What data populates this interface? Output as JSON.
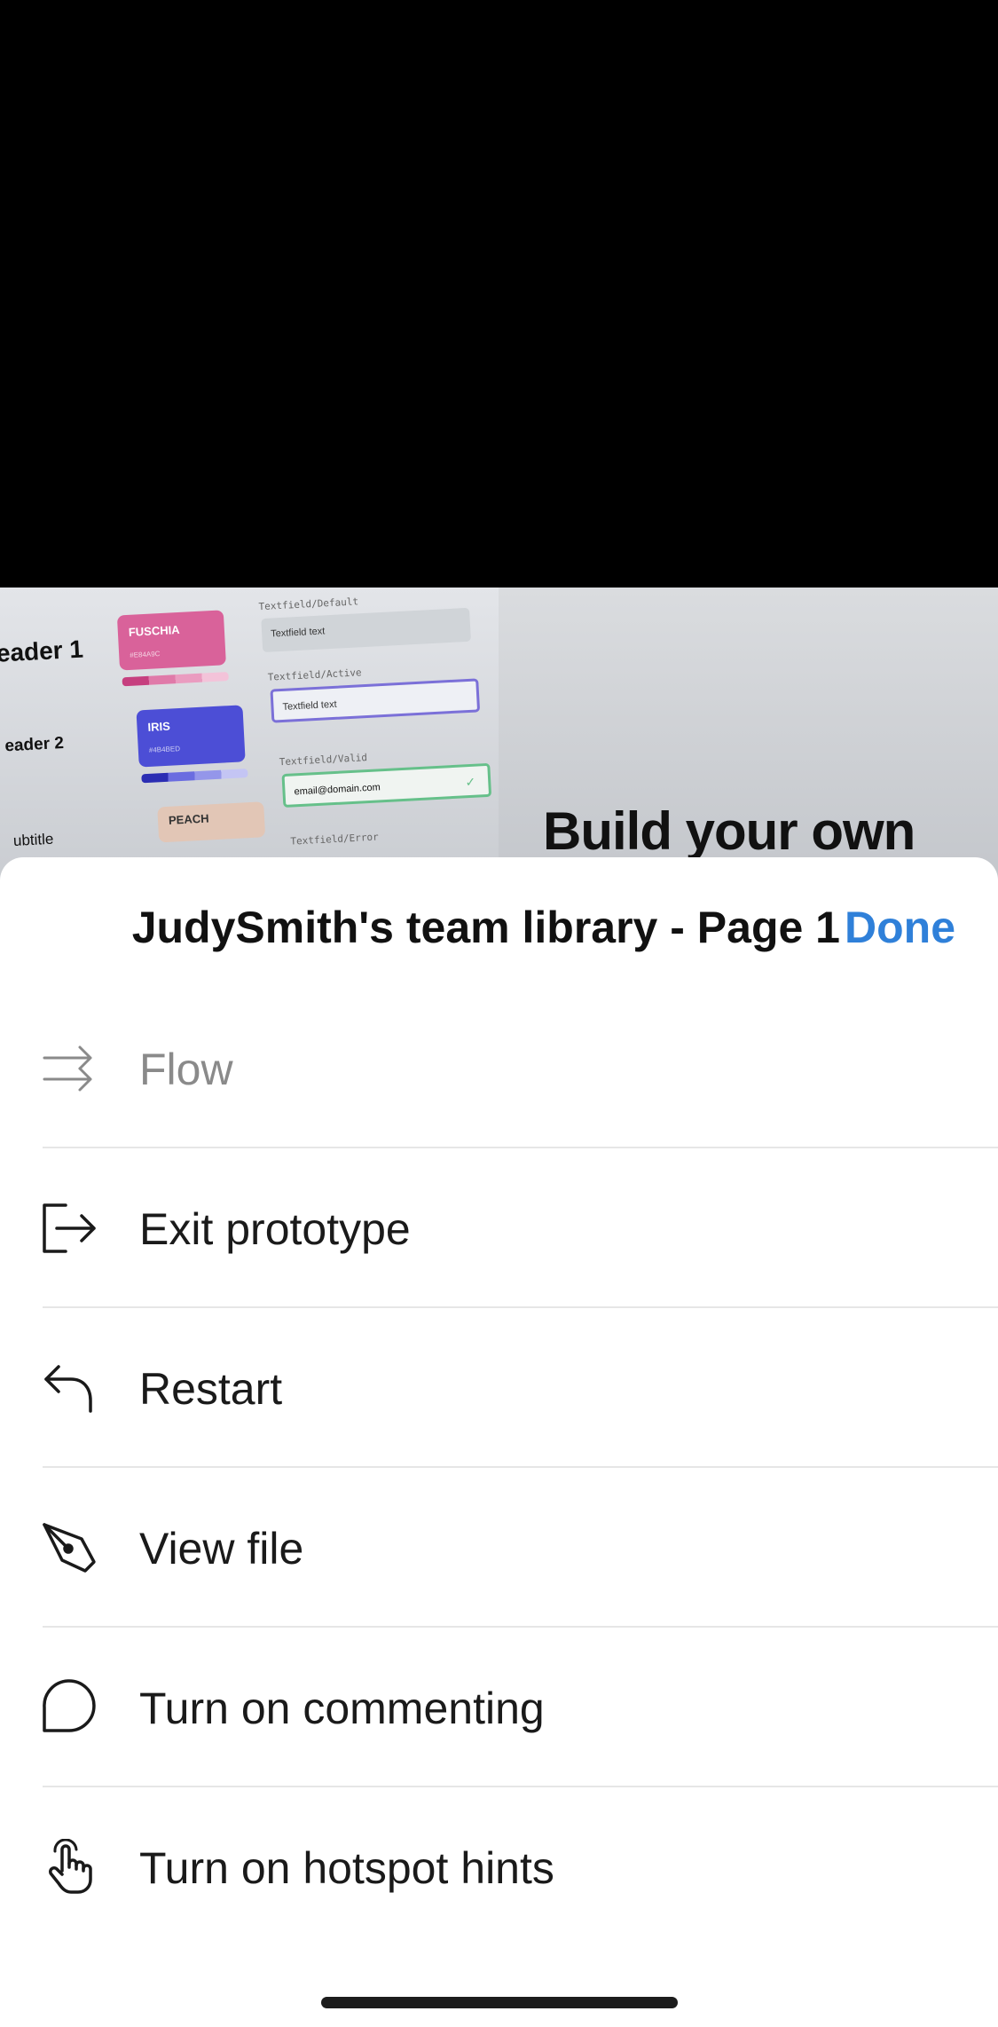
{
  "preview": {
    "header1": "eader 1",
    "header2": "eader 2",
    "subtitle": "ubtitle",
    "swatch_fuschia": "FUSCHIA",
    "swatch_fuschia_hex": "#E84A9C",
    "swatch_iris": "IRIS",
    "swatch_iris_hex": "#4B4BED",
    "swatch_peach": "PEACH",
    "tf_default_label": "Textfield/Default",
    "tf_default_text": "Textfield text",
    "tf_active_label": "Textfield/Active",
    "tf_active_text": "Textfield text",
    "tf_valid_label": "Textfield/Valid",
    "tf_valid_text": "email@domain.com",
    "tf_error_label": "Textfield/Error",
    "build_text": "Build your own",
    "colors": {
      "fuschia": "#d9629a",
      "iris": "#4c4ed6",
      "peach": "#e2c6b6"
    }
  },
  "sheet": {
    "title": "JudySmith's team library - Page 1",
    "done_label": "Done",
    "accent": "#2f80d9"
  },
  "menu": [
    {
      "id": "flow",
      "label": "Flow",
      "icon": "flow-arrows-icon",
      "disabled": true
    },
    {
      "id": "exit",
      "label": "Exit prototype",
      "icon": "exit-icon",
      "disabled": false
    },
    {
      "id": "restart",
      "label": "Restart",
      "icon": "restart-arrow-icon",
      "disabled": false
    },
    {
      "id": "view",
      "label": "View file",
      "icon": "pen-tool-icon",
      "disabled": false
    },
    {
      "id": "comment",
      "label": "Turn on commenting",
      "icon": "comment-bubble-icon",
      "disabled": false
    },
    {
      "id": "hotspot",
      "label": "Turn on hotspot hints",
      "icon": "hand-pointer-icon",
      "disabled": false
    }
  ]
}
